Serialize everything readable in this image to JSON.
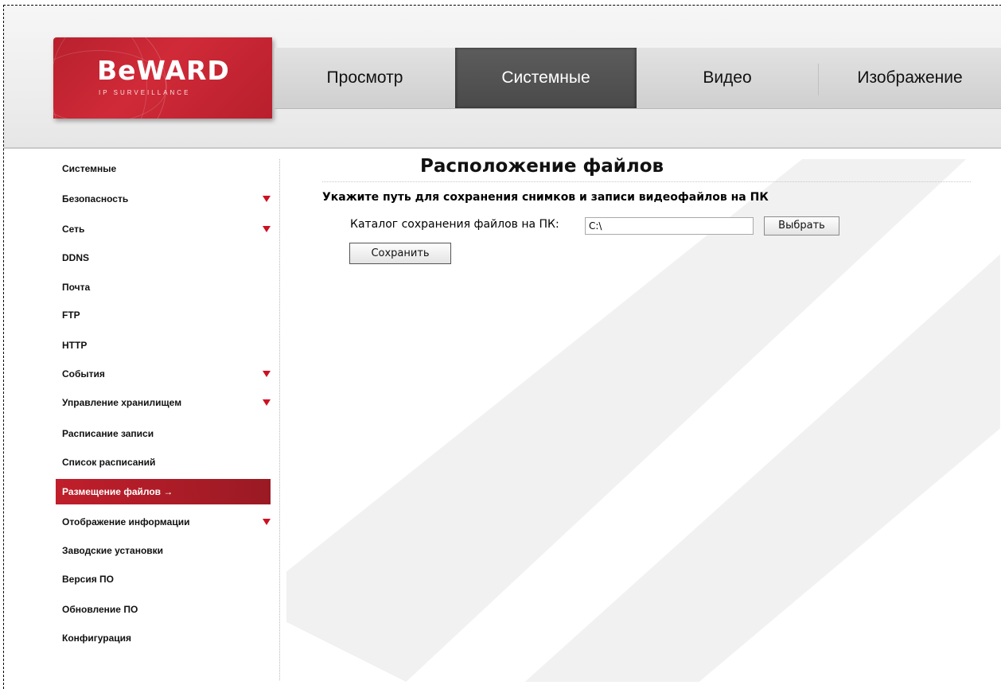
{
  "brand": {
    "name": "BeWARD",
    "tagline": "IP SURVEILLANCE"
  },
  "nav": {
    "tabs": [
      {
        "label": "Просмотр",
        "active": false
      },
      {
        "label": "Системные",
        "active": true
      },
      {
        "label": "Видео",
        "active": false
      },
      {
        "label": "Изображение",
        "active": false
      }
    ]
  },
  "sidebar": {
    "items": [
      {
        "label": "Системные"
      },
      {
        "label": "Безопасность",
        "expandable": true
      },
      {
        "label": "Сеть",
        "expandable": true
      },
      {
        "label": "DDNS"
      },
      {
        "label": "Почта"
      },
      {
        "label": "FTP"
      },
      {
        "label": "HTTP"
      },
      {
        "label": "События",
        "expandable": true
      },
      {
        "label": "Управление хранилищем",
        "expandable": true
      },
      {
        "label": "Расписание записи"
      },
      {
        "label": "Список расписаний"
      },
      {
        "label": "Размещение файлов →",
        "active": true
      },
      {
        "label": "Отображение информации",
        "expandable": true
      },
      {
        "label": "Заводские установки"
      },
      {
        "label": "Версия ПО"
      },
      {
        "label": "Обновление ПО"
      },
      {
        "label": "Конфигурация"
      }
    ]
  },
  "main": {
    "title": "Расположение файлов",
    "subtitle": "Укажите путь для сохранения снимков и записи видеофайлов на ПК",
    "path_label": "Каталог сохранения файлов на ПК:",
    "path_value": "C:\\",
    "choose_label": "Выбрать",
    "save_label": "Сохранить"
  },
  "colors": {
    "accent": "#c01e2b",
    "nav_active": "#4f4f4f",
    "triangle": "#cc1122"
  }
}
